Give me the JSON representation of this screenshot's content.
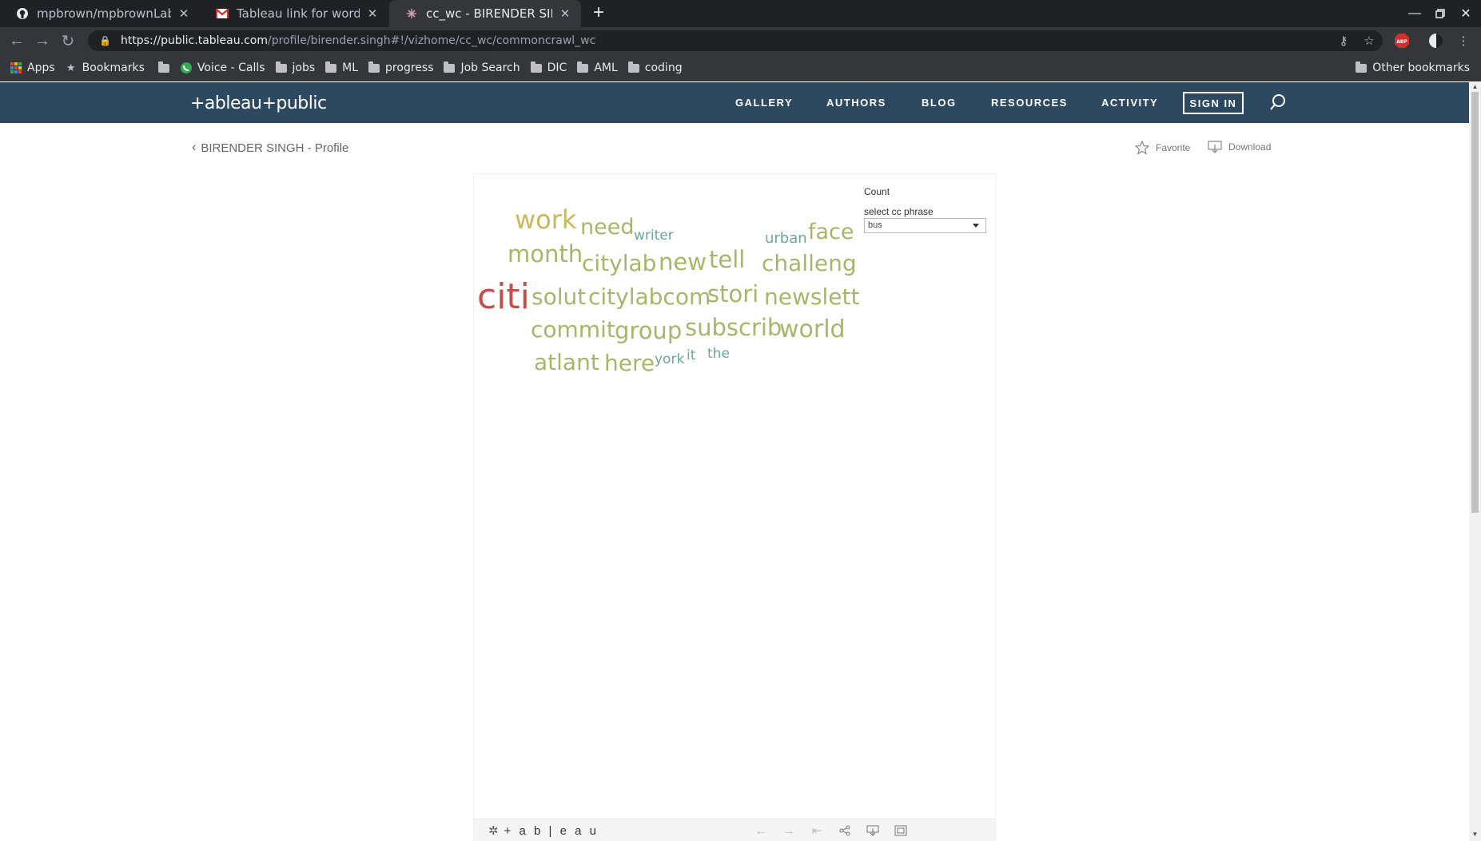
{
  "browser": {
    "tabs": [
      {
        "title": "mpbrown/mpbrownLab2",
        "icon": "github-icon"
      },
      {
        "title": "Tableau link for wordcou",
        "icon": "gmail-icon"
      },
      {
        "title": "cc_wc - BIRENDER SINGH",
        "icon": "tableau-icon",
        "active": true
      }
    ],
    "url_host": "https://public.tableau.com",
    "url_path": "/profile/birender.singh#!/vizhome/cc_wc/commoncrawl_wc",
    "bookmarks": [
      {
        "label": "Apps",
        "icon": "apps-grid-icon"
      },
      {
        "label": "Bookmarks",
        "icon": "star-icon"
      },
      {
        "label": "",
        "icon": "folder-icon"
      },
      {
        "label": "Voice - Calls",
        "icon": "voice-icon"
      },
      {
        "label": "jobs",
        "icon": "folder-icon"
      },
      {
        "label": "ML",
        "icon": "folder-icon"
      },
      {
        "label": "progress",
        "icon": "folder-icon"
      },
      {
        "label": "Job Search",
        "icon": "folder-icon"
      },
      {
        "label": "DIC",
        "icon": "folder-icon"
      },
      {
        "label": "AML",
        "icon": "folder-icon"
      },
      {
        "label": "coding",
        "icon": "folder-icon"
      }
    ],
    "other_bookmarks": "Other bookmarks",
    "extension_badge": "ABP"
  },
  "site": {
    "logo": "+ableau+public",
    "nav": [
      "GALLERY",
      "AUTHORS",
      "BLOG",
      "RESOURCES",
      "ACTIVITY"
    ],
    "signin": "SIGN IN",
    "colors": {
      "header": "#2d4960"
    }
  },
  "profile": {
    "back_label": "BIRENDER SINGH - Profile",
    "favorite_label": "Favorite",
    "download_label": "Download"
  },
  "viz": {
    "legend_title": "Count",
    "filter_label": "select cc phrase",
    "filter_value": "bus",
    "footer_brand": "+ a b | e a u",
    "words": [
      {
        "text": "work",
        "color": "#c9b95a"
      },
      {
        "text": "need",
        "color": "#a9b56a"
      },
      {
        "text": "writer",
        "color": "#6aa898"
      },
      {
        "text": "urban",
        "color": "#6aa898"
      },
      {
        "text": "face",
        "color": "#a9b56a"
      },
      {
        "text": "month",
        "color": "#a9b56a"
      },
      {
        "text": "citylab",
        "color": "#a9b56a"
      },
      {
        "text": "new",
        "color": "#a9b56a"
      },
      {
        "text": "tell",
        "color": "#a9b56a"
      },
      {
        "text": "challeng",
        "color": "#a9b56a"
      },
      {
        "text": "citi",
        "color": "#c0504d"
      },
      {
        "text": "solut",
        "color": "#a9b56a"
      },
      {
        "text": "citylabcom",
        "color": "#a9b56a"
      },
      {
        "text": "stori",
        "color": "#a9b56a"
      },
      {
        "text": "newslett",
        "color": "#a9b56a"
      },
      {
        "text": "commit",
        "color": "#a9b56a"
      },
      {
        "text": "group",
        "color": "#a9b56a"
      },
      {
        "text": "subscrib",
        "color": "#a9b56a"
      },
      {
        "text": "world",
        "color": "#a9b56a"
      },
      {
        "text": "atlant",
        "color": "#a9b56a"
      },
      {
        "text": "here",
        "color": "#a9b56a"
      },
      {
        "text": "york",
        "color": "#6aa898"
      },
      {
        "text": "it",
        "color": "#6aa898"
      },
      {
        "text": "the",
        "color": "#6aa898"
      }
    ]
  }
}
